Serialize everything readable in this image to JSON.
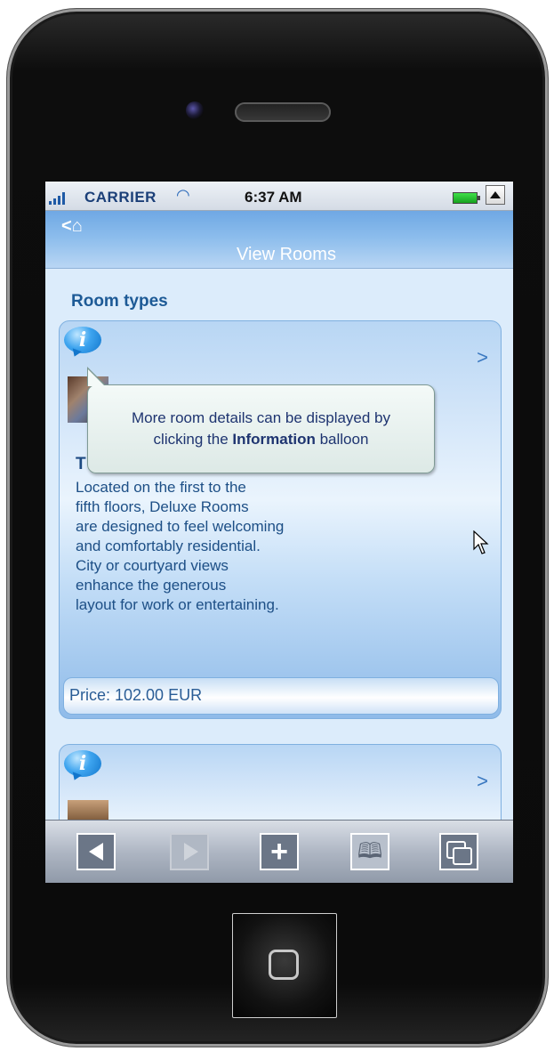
{
  "status_bar": {
    "carrier": "CARRIER",
    "time": "6:37 AM",
    "wifi_icon": "wifi-icon",
    "battery_icon": "battery-icon"
  },
  "nav": {
    "back_home_label": "<⌂",
    "title": "View Rooms"
  },
  "content": {
    "section_title": "Room types",
    "rooms": [
      {
        "name_initial": "T",
        "description_lines": [
          "Located on the first to the",
          "fifth floors, Deluxe Rooms",
          "are designed to feel welcoming",
          "and comfortably residential.",
          "City or courtyard views",
          "enhance the generous",
          "layout for work or entertaining."
        ],
        "price": "Price: 102.00 EUR"
      },
      {
        "name_initial": "",
        "description_lines": [],
        "price": ""
      }
    ],
    "info_glyph": "i",
    "chevron_glyph": ">"
  },
  "tooltip": {
    "line1": "More room details can be displayed by",
    "line2_pre": "clicking the ",
    "line2_bold": "Information",
    "line2_post": " balloon"
  },
  "toolbar": {
    "add_glyph": "+",
    "bookmarks_glyph": "🕮"
  },
  "colors": {
    "nav_top": "#6fa8e4",
    "screen_bg": "#dcecfb",
    "accent_text": "#1d5a96",
    "toolbar": "#8f99a8"
  }
}
